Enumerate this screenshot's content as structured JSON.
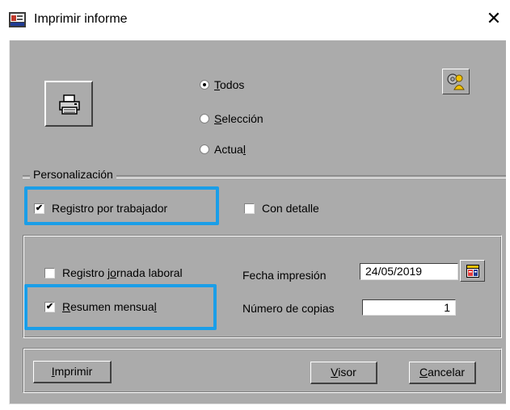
{
  "window": {
    "title": "Imprimir informe",
    "close_symbol": "✕"
  },
  "scope_options": {
    "todos": {
      "first": "T",
      "rest": "odos",
      "selected": true
    },
    "seleccion": {
      "first": "S",
      "rest": "elección",
      "selected": false
    },
    "actual": {
      "prefix": "Actua",
      "underlined": "l",
      "selected": false
    }
  },
  "personalizacion": {
    "label": "Personalización",
    "registro_por_trabajador": {
      "label": "Registro por trabajador",
      "checked": true
    },
    "con_detalle": {
      "label": "Con detalle",
      "checked": false
    }
  },
  "options": {
    "registro_jornada": {
      "prefix": "Registro j",
      "underlined": "o",
      "rest": "rnada laboral",
      "checked": false
    },
    "resumen_mensual": {
      "first": "R",
      "rest": "esumen mensua",
      "last": "l",
      "checked": true
    },
    "fecha_impresion_label": "Fecha impresión",
    "fecha_impresion_value": "24/05/2019",
    "numero_copias_label": "Número de copias",
    "numero_copias_value": "1"
  },
  "buttons": {
    "imprimir": {
      "first": "I",
      "rest": "mprimir"
    },
    "visor": {
      "first": "V",
      "rest": "isor"
    },
    "cancelar": {
      "first": "C",
      "rest": "ancelar"
    }
  },
  "checkmark": "✔",
  "icons": {
    "app": "report-app-icon",
    "printer": "printer-icon",
    "help": "settings-help-icon",
    "calendar": "calendar-icon"
  },
  "colors": {
    "dialog_bg": "#ababab",
    "highlight": "#1a9ee8"
  }
}
